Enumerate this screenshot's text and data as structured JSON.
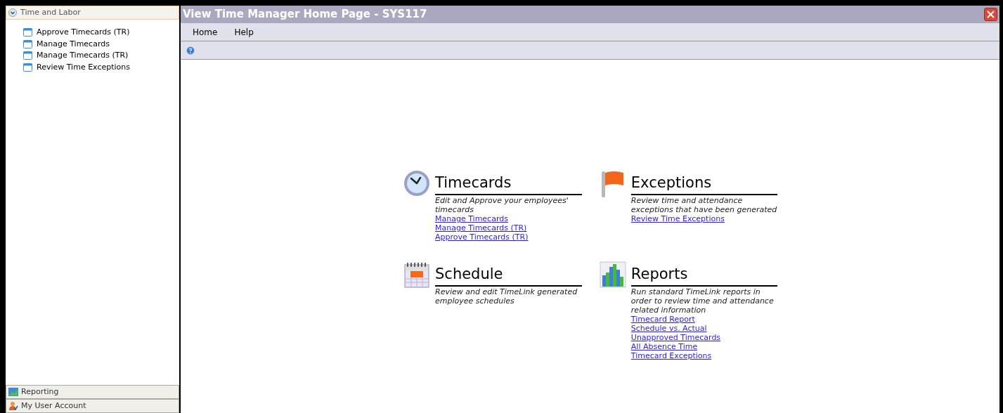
{
  "sidebar": {
    "header": "Time and Labor",
    "expanded": true,
    "items": [
      {
        "label": "Approve Timecards (TR)"
      },
      {
        "label": "Manage Timecards"
      },
      {
        "label": "Manage Timecards (TR)"
      },
      {
        "label": "Review Time Exceptions"
      }
    ],
    "bottom_panels": [
      {
        "kind": "reporting",
        "label": "Reporting"
      },
      {
        "kind": "account",
        "label": "My User Account"
      }
    ]
  },
  "window": {
    "title": "View Time Manager Home Page - SYS117"
  },
  "menu": [
    "Home",
    "Help"
  ],
  "sections": [
    {
      "kind": "clock",
      "title": "Timecards",
      "description": "Edit and Approve your employees' timecards",
      "links": [
        "Manage Timecards",
        "Manage Timecards (TR)",
        "Approve Timecards (TR)"
      ]
    },
    {
      "kind": "flag",
      "title": "Exceptions",
      "description": "Review time and attendance exceptions that have been generated",
      "links": [
        "Review Time Exceptions"
      ]
    },
    {
      "kind": "calendar",
      "title": "Schedule",
      "description": "Review and edit TimeLink generated employee schedules"
    },
    {
      "kind": "chart",
      "title": "Reports",
      "description": "Run standard TimeLink reports in order to review time and attendance related information",
      "links": [
        "Timecard Report",
        "Schedule vs. Actual",
        "Unapproved Timecards",
        "All Absence Time",
        "Timecard Exceptions"
      ]
    }
  ]
}
